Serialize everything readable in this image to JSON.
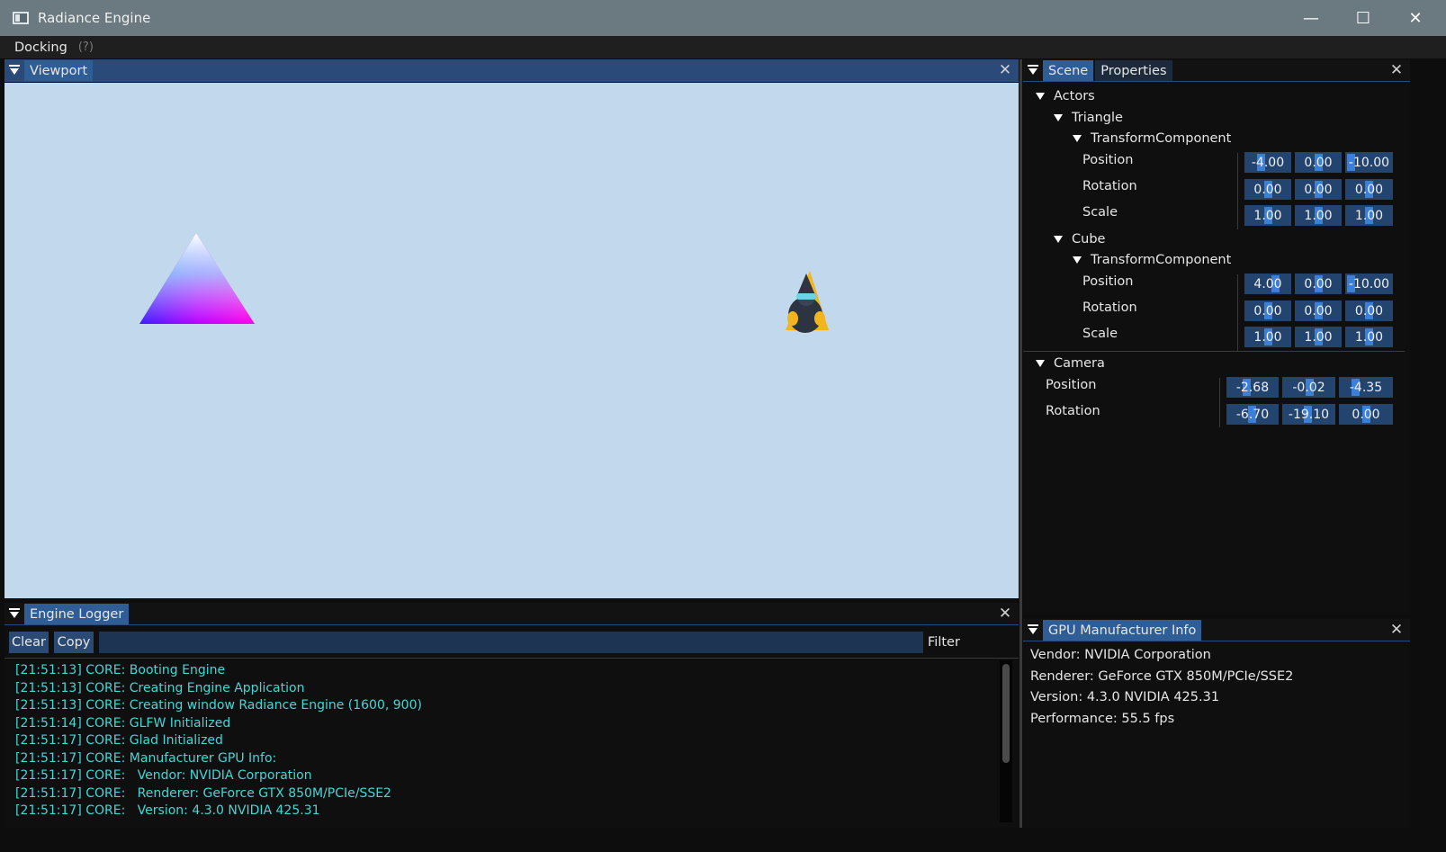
{
  "window": {
    "title": "Radiance Engine",
    "minimize": "—",
    "maximize": "☐",
    "close": "✕"
  },
  "menu": {
    "docking": "Docking",
    "help": "(?)"
  },
  "viewport": {
    "tab": "Viewport"
  },
  "scene_panel": {
    "tabs": [
      "Scene",
      "Properties"
    ],
    "actors_label": "Actors",
    "triangle": {
      "label": "Triangle",
      "component": "TransformComponent",
      "position": [
        "-4.00",
        "0.00",
        "-10.00"
      ],
      "rotation": [
        "0.00",
        "0.00",
        "0.00"
      ],
      "scale": [
        "1.00",
        "1.00",
        "1.00"
      ]
    },
    "cube": {
      "label": "Cube",
      "component": "TransformComponent",
      "position": [
        "4.00",
        "0.00",
        "-10.00"
      ],
      "rotation": [
        "0.00",
        "0.00",
        "0.00"
      ],
      "scale": [
        "1.00",
        "1.00",
        "1.00"
      ]
    },
    "camera": {
      "label": "Camera",
      "position": [
        "-2.68",
        "-0.02",
        "-4.35"
      ],
      "rotation": [
        "-6.70",
        "-19.10",
        "0.00"
      ]
    },
    "labels": {
      "position": "Position",
      "rotation": "Rotation",
      "scale": "Scale"
    }
  },
  "logger": {
    "tab": "Engine Logger",
    "clear": "Clear",
    "copy": "Copy",
    "filter_label": "Filter",
    "filter_value": "",
    "lines": [
      "[21:51:13] CORE: Booting Engine",
      "[21:51:13] CORE: Creating Engine Application",
      "[21:51:13] CORE: Creating window Radiance Engine (1600, 900)",
      "[21:51:14] CORE: GLFW Initialized",
      "[21:51:17] CORE: Glad Initialized",
      "[21:51:17] CORE: Manufacturer GPU Info:",
      "[21:51:17] CORE:   Vendor: NVIDIA Corporation",
      "[21:51:17] CORE:   Renderer: GeForce GTX 850M/PCIe/SSE2",
      "[21:51:17] CORE:   Version: 4.3.0 NVIDIA 425.31"
    ]
  },
  "gpu_panel": {
    "tab": "GPU Manufacturer Info",
    "vendor": "Vendor: NVIDIA Corporation",
    "renderer": "Renderer: GeForce GTX 850M/PCIe/SSE2",
    "version": "Version: 4.3.0 NVIDIA 425.31",
    "performance": "Performance: 55.5 fps"
  },
  "colors": {
    "viewport_bg": "#c2d8ec",
    "accent": "#2f5d96",
    "field_bg": "#22446e",
    "log_text": "#45d6d6"
  }
}
